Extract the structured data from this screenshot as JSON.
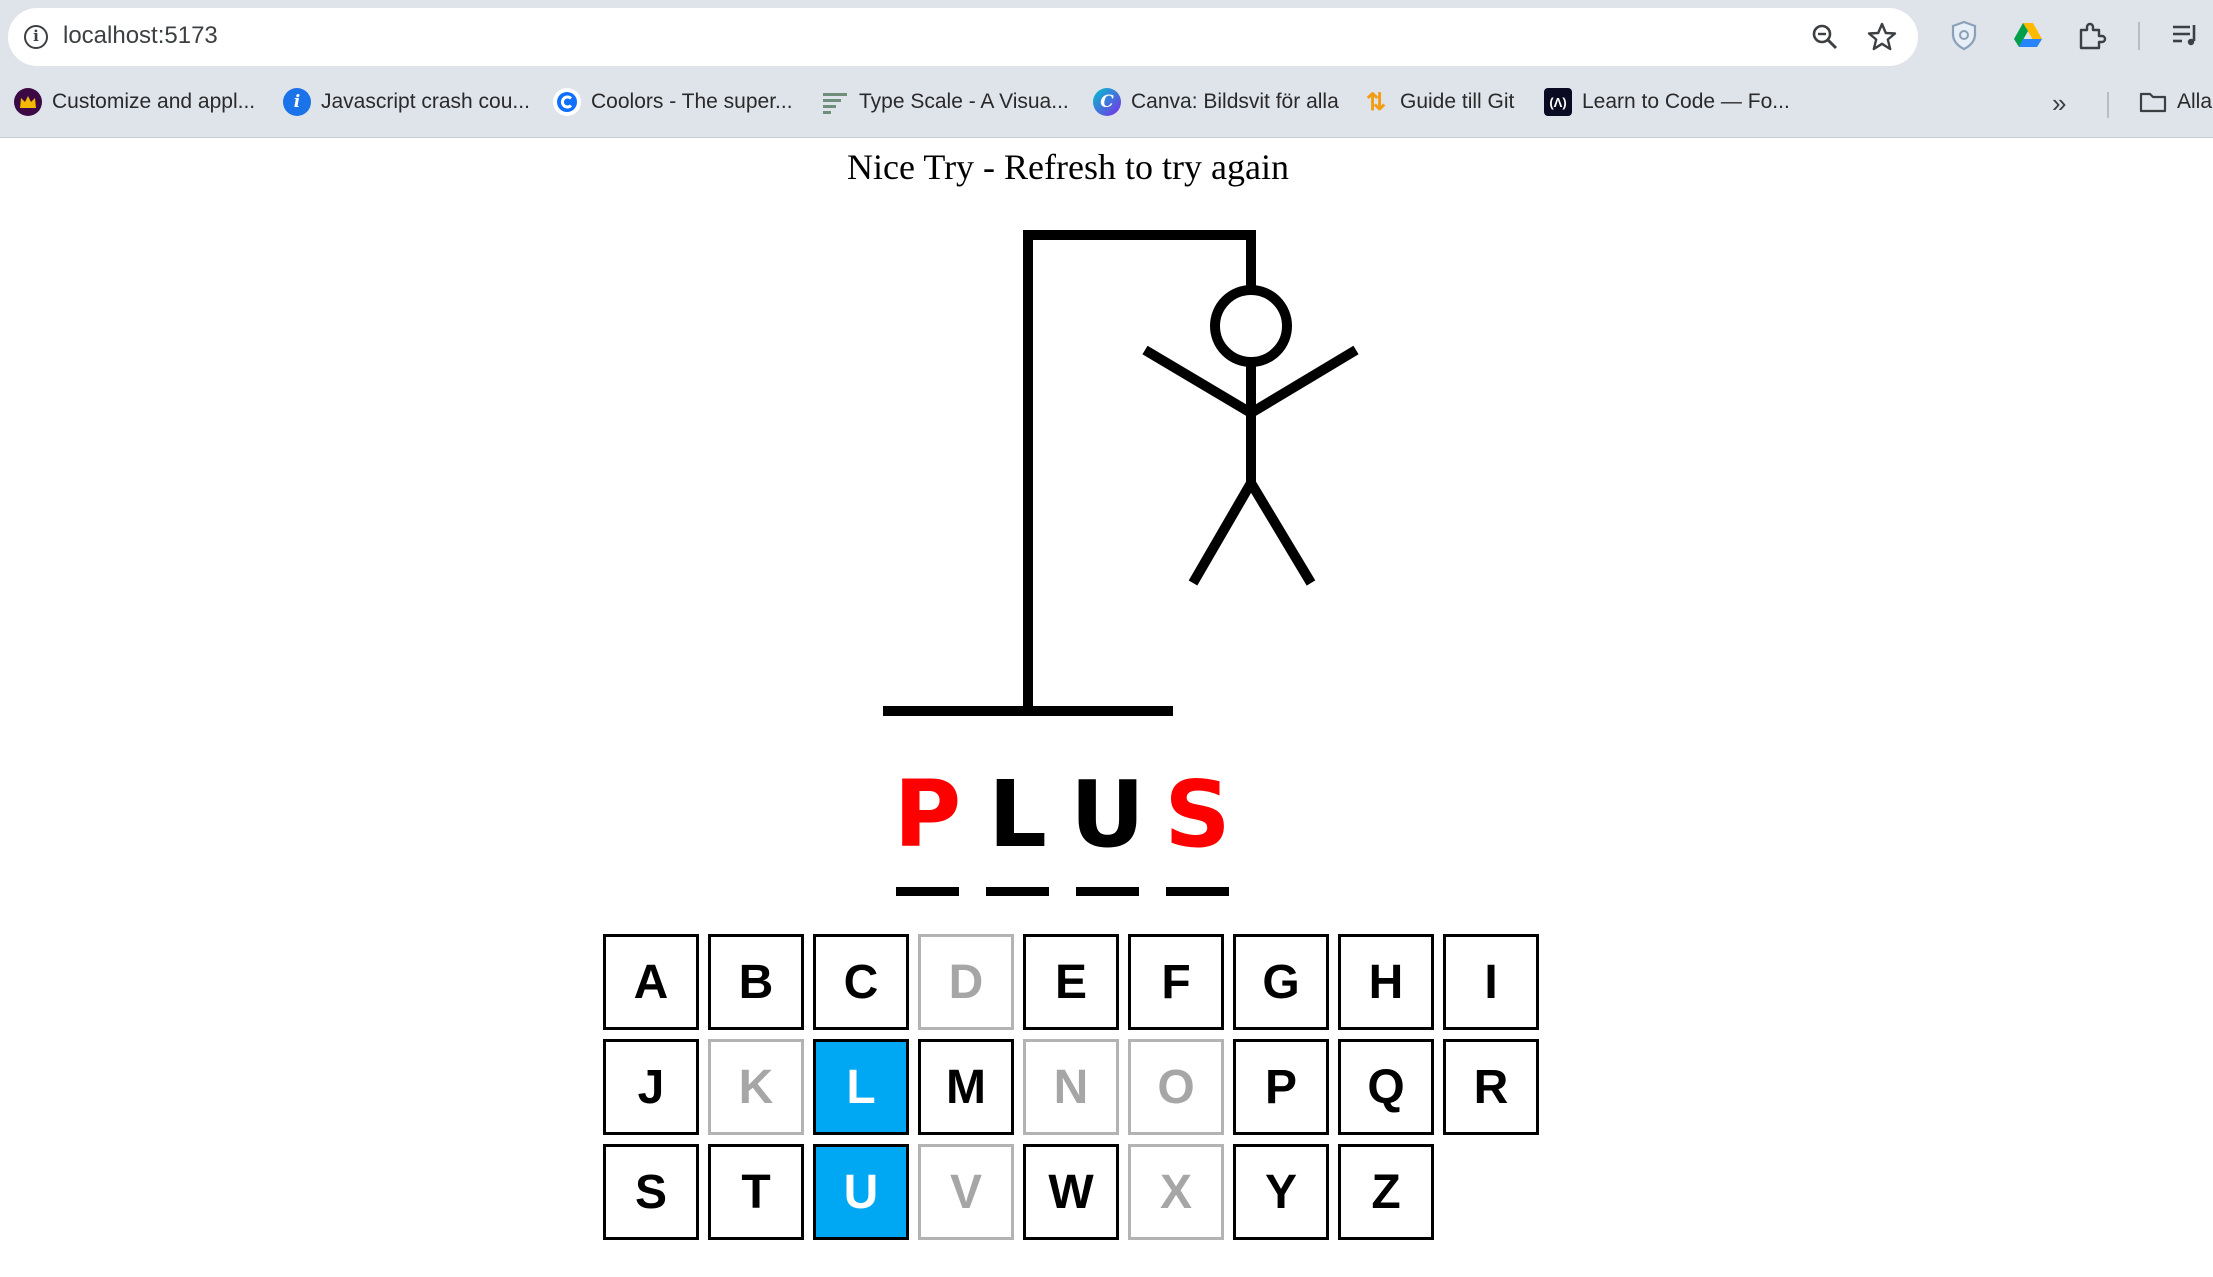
{
  "browser": {
    "url": "localhost:5173",
    "bookmarks": [
      {
        "label": "Customize and appl...",
        "icon": "crown-icon",
        "color": "#3b0a45"
      },
      {
        "label": "Javascript crash cou...",
        "icon": "info-circle-icon",
        "color": "#1a73e8"
      },
      {
        "label": "Coolors - The super...",
        "icon": "coolors-icon",
        "color": "#0f6fff"
      },
      {
        "label": "Type Scale - A Visua...",
        "icon": "type-scale-icon",
        "color": "#6f8f7a"
      },
      {
        "label": "Canva: Bildsvit för alla",
        "icon": "canva-icon",
        "color": "#7d2ae8"
      },
      {
        "label": "Guide till Git",
        "icon": "git-guide-icon",
        "color": "#f39c12"
      },
      {
        "label": "Learn to Code — Fo...",
        "icon": "freecodecamp-icon",
        "color": "#0a0a23"
      }
    ],
    "all_bookmarks_label": "Alla"
  },
  "game": {
    "status": "Nice Try - Refresh to try again",
    "word": [
      {
        "letter": "P",
        "state": "missed"
      },
      {
        "letter": "L",
        "state": "guessed"
      },
      {
        "letter": "U",
        "state": "guessed"
      },
      {
        "letter": "S",
        "state": "missed"
      }
    ],
    "keys": [
      {
        "letter": "A",
        "state": "default"
      },
      {
        "letter": "B",
        "state": "default"
      },
      {
        "letter": "C",
        "state": "default"
      },
      {
        "letter": "D",
        "state": "disabled"
      },
      {
        "letter": "E",
        "state": "default"
      },
      {
        "letter": "F",
        "state": "default"
      },
      {
        "letter": "G",
        "state": "default"
      },
      {
        "letter": "H",
        "state": "default"
      },
      {
        "letter": "I",
        "state": "default"
      },
      {
        "letter": "J",
        "state": "default"
      },
      {
        "letter": "K",
        "state": "disabled"
      },
      {
        "letter": "L",
        "state": "active"
      },
      {
        "letter": "M",
        "state": "default"
      },
      {
        "letter": "N",
        "state": "disabled"
      },
      {
        "letter": "O",
        "state": "disabled"
      },
      {
        "letter": "P",
        "state": "default"
      },
      {
        "letter": "Q",
        "state": "default"
      },
      {
        "letter": "R",
        "state": "default"
      },
      {
        "letter": "S",
        "state": "default"
      },
      {
        "letter": "T",
        "state": "default"
      },
      {
        "letter": "U",
        "state": "active"
      },
      {
        "letter": "V",
        "state": "disabled"
      },
      {
        "letter": "W",
        "state": "default"
      },
      {
        "letter": "X",
        "state": "disabled"
      },
      {
        "letter": "Y",
        "state": "default"
      },
      {
        "letter": "Z",
        "state": "default"
      }
    ]
  },
  "colors": {
    "missed_letter": "#ff0000",
    "active_key": "#00a8f3",
    "disabled_key": "#a6a6a6"
  }
}
